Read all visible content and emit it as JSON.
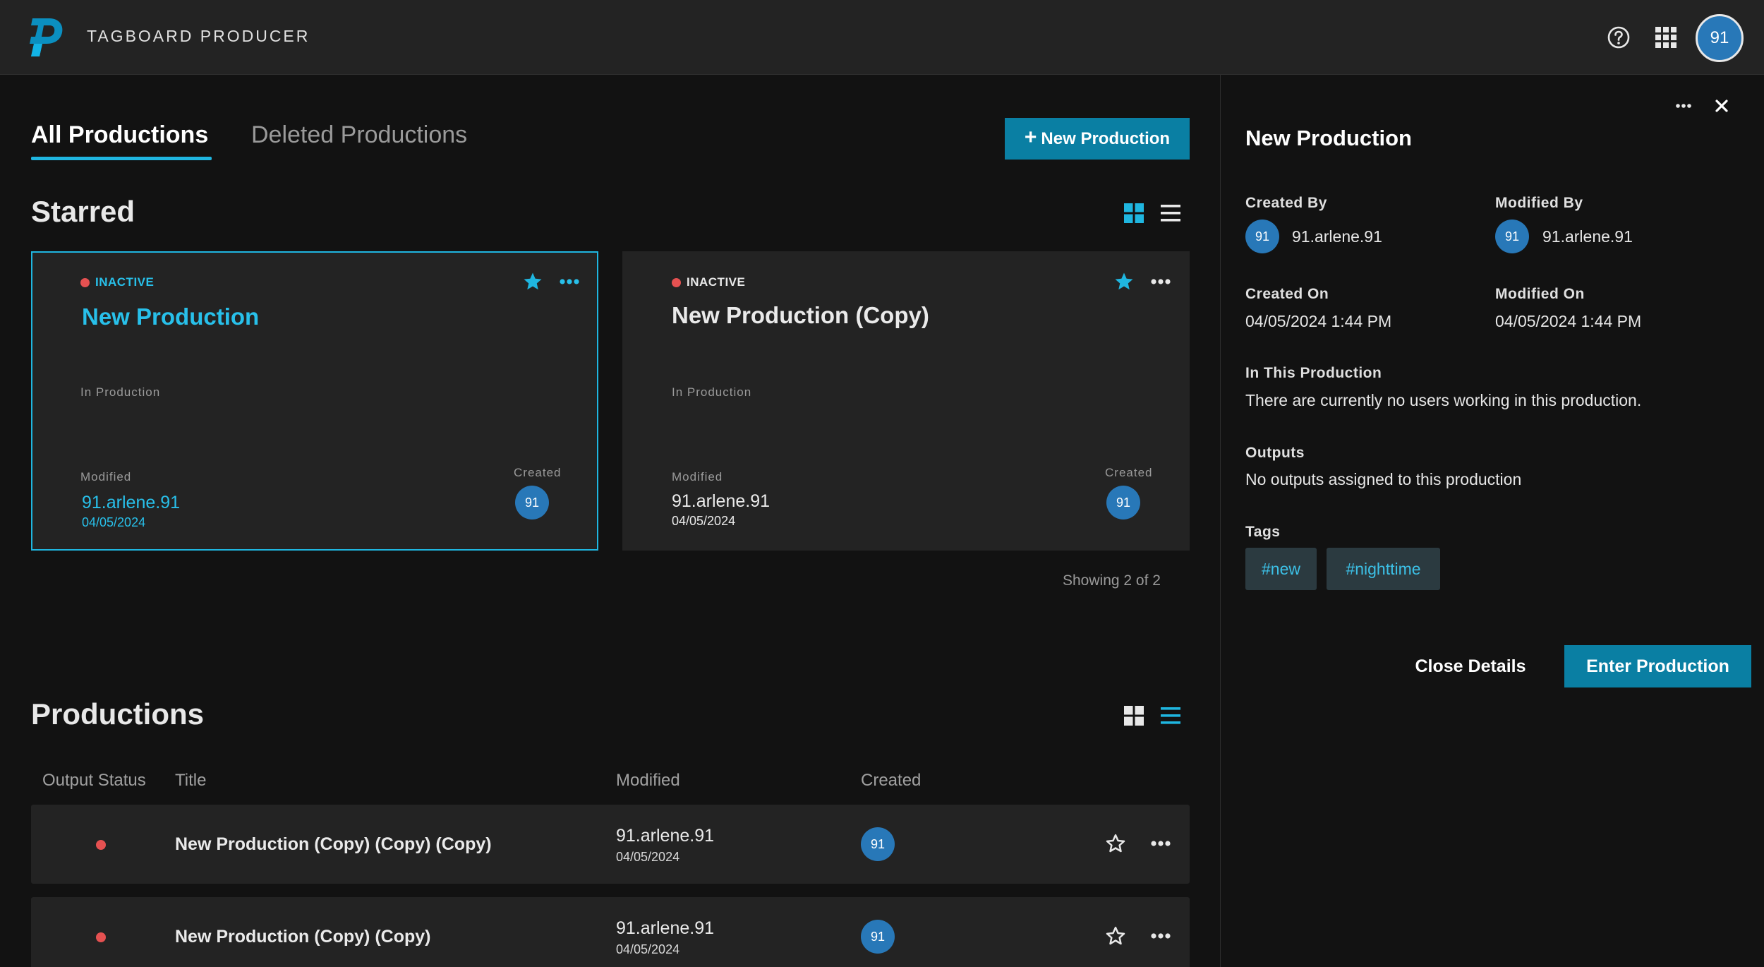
{
  "app": {
    "title": "TAGBOARD PRODUCER",
    "user_initials": "91"
  },
  "colors": {
    "accent": "#1fb6e0",
    "primary_button": "#0a7fa3",
    "inactive_dot": "#e55151",
    "avatar": "#2878b8"
  },
  "tabs": [
    {
      "label": "All Productions",
      "active": true
    },
    {
      "label": "Deleted Productions",
      "active": false
    }
  ],
  "new_production_button": {
    "plus": "+",
    "label": "New Production"
  },
  "starred": {
    "heading": "Starred",
    "cards": [
      {
        "status": "INACTIVE",
        "title": "New Production",
        "phase": "In Production",
        "modified_label": "Modified",
        "modified_by": "91.arlene.91",
        "modified_date": "04/05/2024",
        "created_label": "Created",
        "created_by_initials": "91",
        "starred": true,
        "selected": true
      },
      {
        "status": "INACTIVE",
        "title": "New Production (Copy)",
        "phase": "In Production",
        "modified_label": "Modified",
        "modified_by": "91.arlene.91",
        "modified_date": "04/05/2024",
        "created_label": "Created",
        "created_by_initials": "91",
        "starred": true,
        "selected": false
      }
    ],
    "showing": "Showing 2 of 2"
  },
  "productions": {
    "heading": "Productions",
    "columns": [
      "Output Status",
      "Title",
      "Modified",
      "Created"
    ],
    "rows": [
      {
        "title": "New Production (Copy) (Copy) (Copy)",
        "modified_by": "91.arlene.91",
        "modified_date": "04/05/2024",
        "created_by_initials": "91"
      },
      {
        "title": "New Production (Copy) (Copy)",
        "modified_by": "91.arlene.91",
        "modified_date": "04/05/2024",
        "created_by_initials": "91"
      }
    ]
  },
  "details": {
    "title": "New Production",
    "created_by_label": "Created By",
    "created_by_initials": "91",
    "created_by": "91.arlene.91",
    "modified_by_label": "Modified By",
    "modified_by_initials": "91",
    "modified_by": "91.arlene.91",
    "created_on_label": "Created On",
    "created_on": "04/05/2024 1:44 PM",
    "modified_on_label": "Modified On",
    "modified_on": "04/05/2024 1:44 PM",
    "in_production_label": "In This Production",
    "in_production_text": "There are currently no users working in this production.",
    "outputs_label": "Outputs",
    "outputs_text": "No outputs assigned to this production",
    "tags_label": "Tags",
    "tags": [
      "#new",
      "#nighttime"
    ],
    "close_button": "Close Details",
    "enter_button": "Enter Production"
  }
}
